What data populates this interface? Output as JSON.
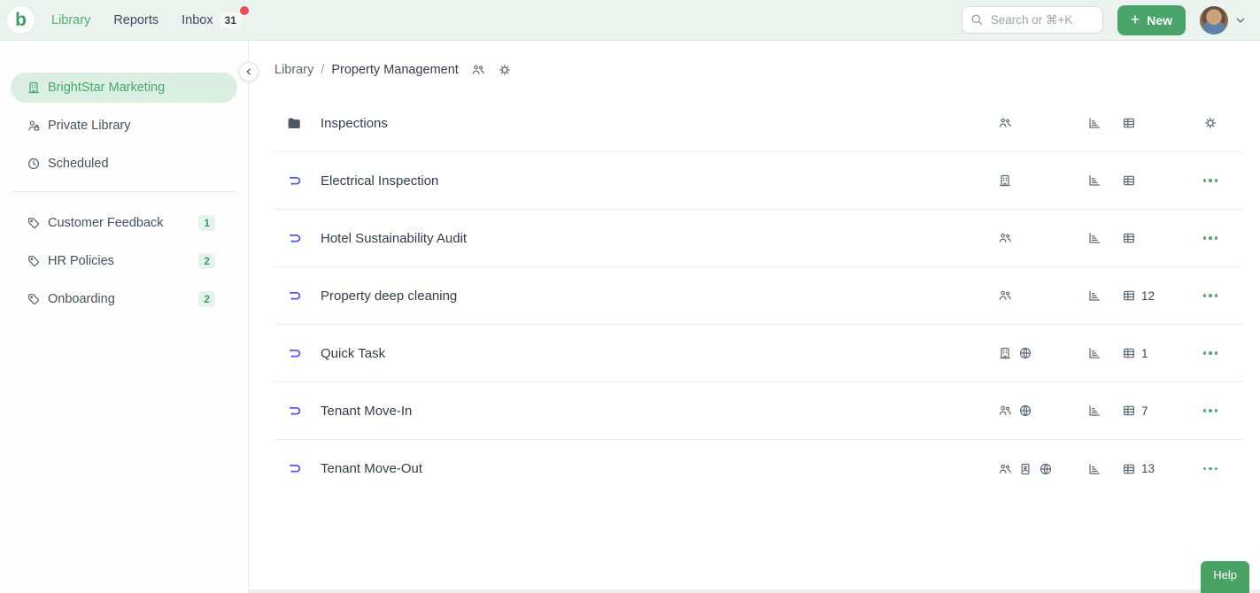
{
  "topbar": {
    "logo_letter": "b",
    "nav": [
      {
        "label": "Library",
        "active": true
      },
      {
        "label": "Reports",
        "active": false
      },
      {
        "label": "Inbox",
        "active": false,
        "badge": "31"
      }
    ],
    "search_placeholder": "Search or ⌘+K",
    "new_button_label": "New",
    "new_button_plus": "+"
  },
  "sidebar": {
    "library_items": [
      {
        "label": "BrightStar Marketing",
        "icon": "building",
        "active": true
      },
      {
        "label": "Private Library",
        "icon": "user-lock",
        "active": false
      },
      {
        "label": "Scheduled",
        "icon": "clock",
        "active": false
      }
    ],
    "tags": [
      {
        "label": "Customer Feedback",
        "count": "1"
      },
      {
        "label": "HR Policies",
        "count": "2"
      },
      {
        "label": "Onboarding",
        "count": "2"
      }
    ]
  },
  "breadcrumb": {
    "parent": "Library",
    "separator": "/",
    "current": "Property Management"
  },
  "main": {
    "rows": [
      {
        "name": "Inspections",
        "type": "folder",
        "share_icons": [
          "user-group"
        ],
        "runs": "",
        "action": "gear"
      },
      {
        "name": "Electrical Inspection",
        "type": "workflow",
        "share_icons": [
          "building"
        ],
        "runs": "",
        "action": "menu"
      },
      {
        "name": "Hotel Sustainability Audit",
        "type": "workflow",
        "share_icons": [
          "user-group"
        ],
        "runs": "",
        "action": "menu"
      },
      {
        "name": "Property deep cleaning",
        "type": "workflow",
        "share_icons": [
          "user-group"
        ],
        "runs": "12",
        "action": "menu"
      },
      {
        "name": "Quick Task",
        "type": "workflow",
        "share_icons": [
          "building",
          "globe"
        ],
        "runs": "1",
        "action": "menu"
      },
      {
        "name": "Tenant Move-In",
        "type": "workflow",
        "share_icons": [
          "user-group",
          "globe"
        ],
        "runs": "7",
        "action": "menu"
      },
      {
        "name": "Tenant Move-Out",
        "type": "workflow",
        "share_icons": [
          "user-group",
          "id-card",
          "globe"
        ],
        "runs": "13",
        "action": "menu"
      }
    ]
  },
  "help_button_label": "Help",
  "colors": {
    "accent_green": "#4aa368",
    "workflow_indigo": "#4f5be7",
    "notification_red": "#ef4b54",
    "topbar_mint": "#eaf3ee"
  }
}
